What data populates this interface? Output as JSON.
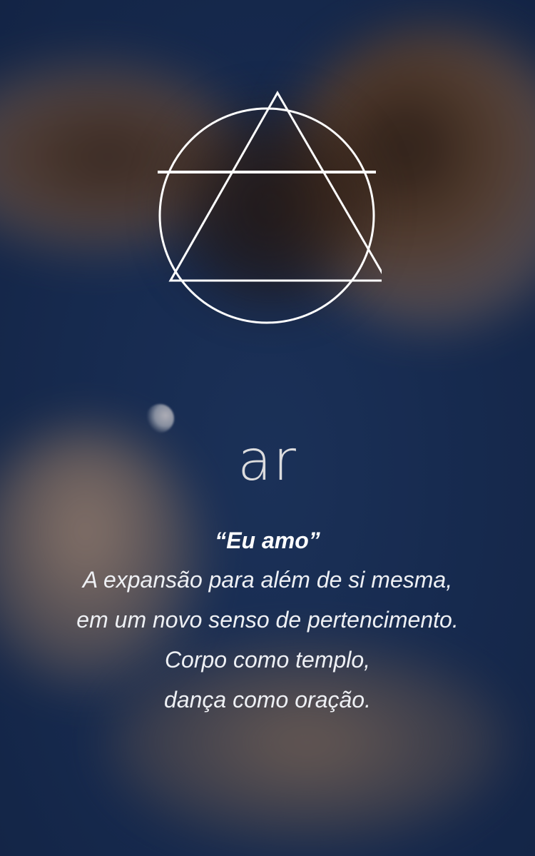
{
  "background": {
    "base_color": "#172a4f",
    "description_icon": "blurred-hands-sky-photo"
  },
  "symbol": {
    "icon": "air-element-symbol-icon",
    "stroke_color": "#ffffff"
  },
  "moon": {
    "icon": "moon-icon"
  },
  "title": "ar",
  "poem": {
    "quote": "“Eu amo”",
    "lines": [
      "A expansão para além de si mesma,",
      "em um novo senso de pertencimento.",
      "Corpo como templo,",
      "dança como oração."
    ]
  }
}
